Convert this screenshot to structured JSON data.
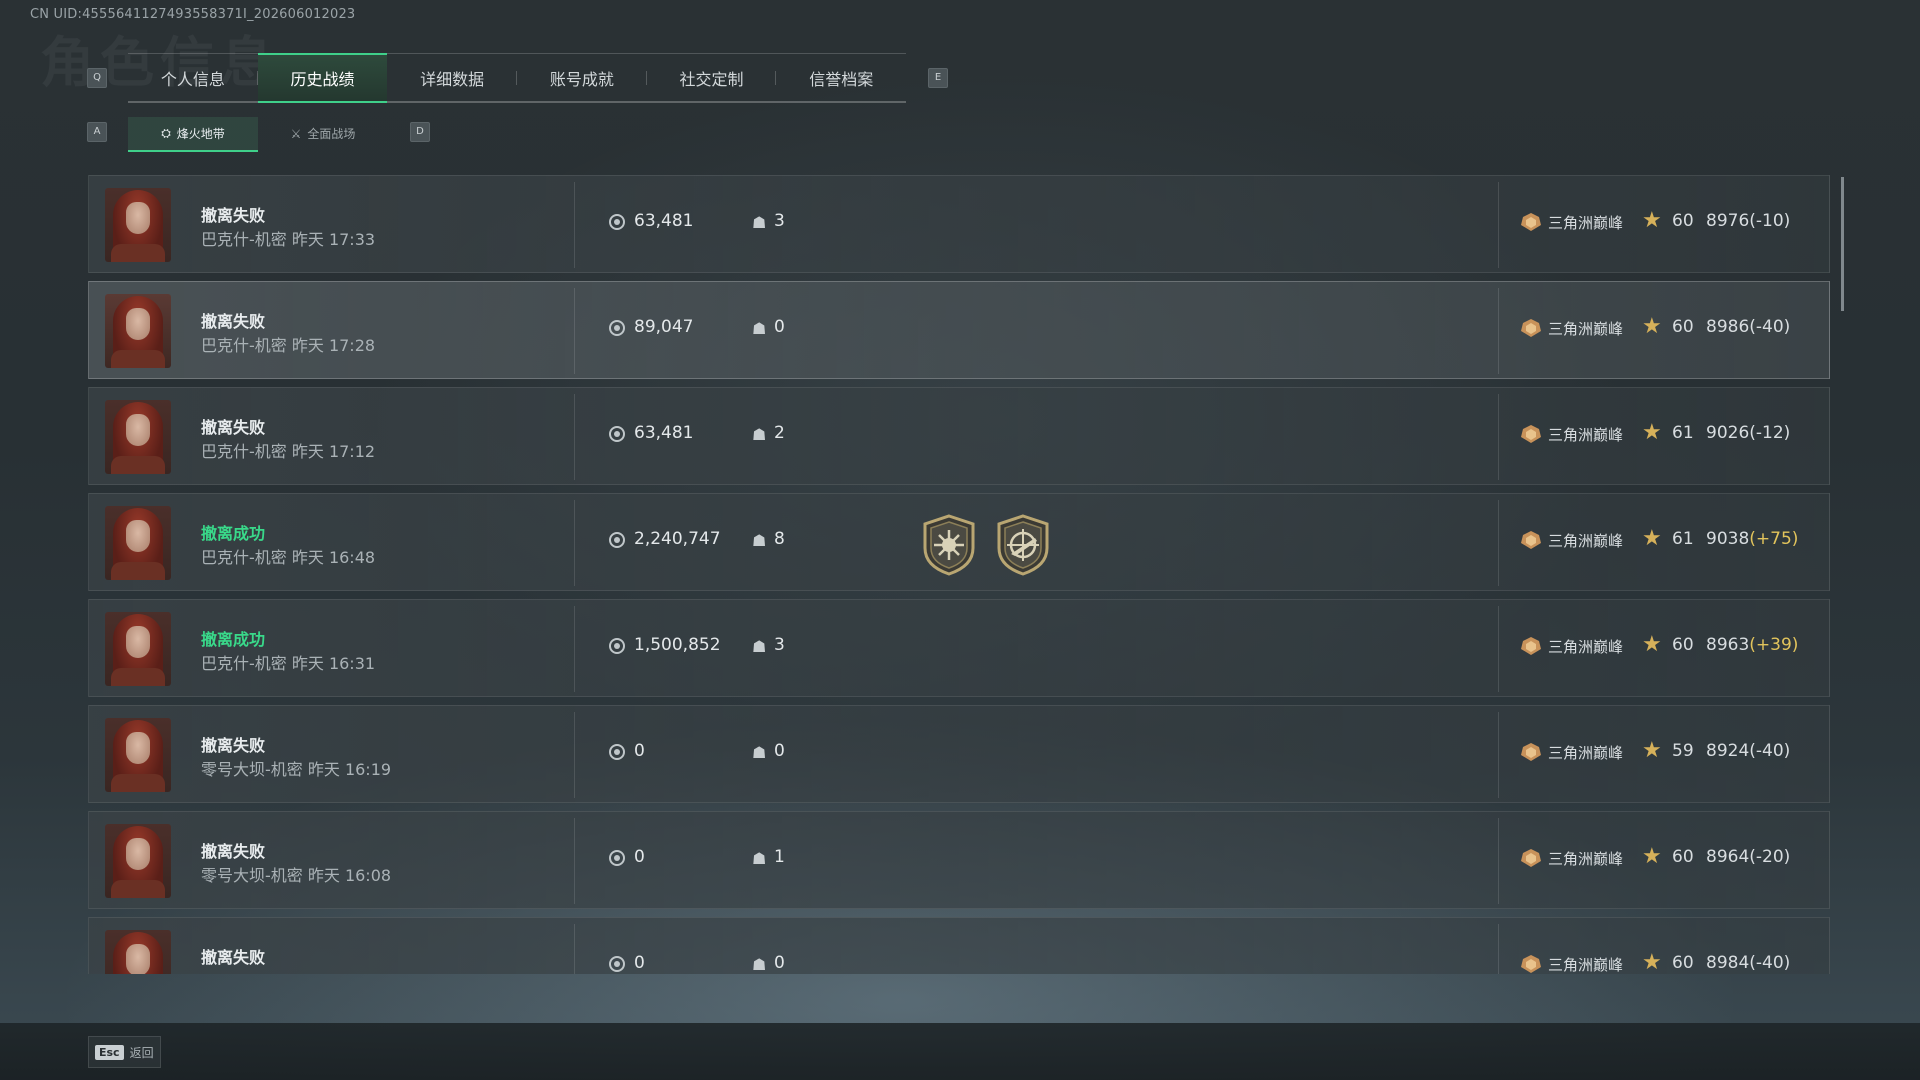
{
  "uid_text": "CN UID:4555641127493558371I_202606012023",
  "ghost_title": "角色信息",
  "keys": {
    "q": "Q",
    "e": "E",
    "a": "A",
    "d": "D"
  },
  "tabs": [
    {
      "label": "个人信息",
      "active": false
    },
    {
      "label": "历史战绩",
      "active": true
    },
    {
      "label": "详细数据",
      "active": false
    },
    {
      "label": "账号成就",
      "active": false
    },
    {
      "label": "社交定制",
      "active": false
    },
    {
      "label": "信誉档案",
      "active": false
    }
  ],
  "subtabs": [
    {
      "label": "烽火地带",
      "icon": "hazard-zone-icon",
      "active": true
    },
    {
      "label": "全面战场",
      "icon": "battlefield-icon",
      "active": false
    }
  ],
  "rows": [
    {
      "status": "撤离失败",
      "success": false,
      "map": "巴克什-机密 昨天 17:33",
      "money": "63,481",
      "kills": "3",
      "medals": [],
      "rank": "三角洲巅峰",
      "level": "60",
      "score": "8976",
      "delta": "(-10)",
      "highlight": false
    },
    {
      "status": "撤离失败",
      "success": false,
      "map": "巴克什-机密 昨天 17:28",
      "money": "89,047",
      "kills": "0",
      "medals": [],
      "rank": "三角洲巅峰",
      "level": "60",
      "score": "8986",
      "delta": "(-40)",
      "highlight": true
    },
    {
      "status": "撤离失败",
      "success": false,
      "map": "巴克什-机密 昨天 17:12",
      "money": "63,481",
      "kills": "2",
      "medals": [],
      "rank": "三角洲巅峰",
      "level": "61",
      "score": "9026",
      "delta": "(-12)",
      "highlight": false
    },
    {
      "status": "撤离成功",
      "success": true,
      "map": "巴克什-机密 昨天 16:48",
      "money": "2,240,747",
      "kills": "8",
      "medals": [
        "sun-emblem-medal-icon",
        "crosshair-gun-medal-icon"
      ],
      "rank": "三角洲巅峰",
      "level": "61",
      "score": "9038",
      "delta": "(+75)",
      "highlight": false
    },
    {
      "status": "撤离成功",
      "success": true,
      "map": "巴克什-机密 昨天 16:31",
      "money": "1,500,852",
      "kills": "3",
      "medals": [],
      "rank": "三角洲巅峰",
      "level": "60",
      "score": "8963",
      "delta": "(+39)",
      "highlight": false
    },
    {
      "status": "撤离失败",
      "success": false,
      "map": "零号大坝-机密 昨天 16:19",
      "money": "0",
      "kills": "0",
      "medals": [],
      "rank": "三角洲巅峰",
      "level": "59",
      "score": "8924",
      "delta": "(-40)",
      "highlight": false
    },
    {
      "status": "撤离失败",
      "success": false,
      "map": "零号大坝-机密 昨天 16:08",
      "money": "0",
      "kills": "1",
      "medals": [],
      "rank": "三角洲巅峰",
      "level": "60",
      "score": "8964",
      "delta": "(-20)",
      "highlight": false
    },
    {
      "status": "撤离失败",
      "success": false,
      "map": "",
      "money": "0",
      "kills": "0",
      "medals": [],
      "rank": "三角洲巅峰",
      "level": "60",
      "score": "8984",
      "delta": "(-40)",
      "highlight": false
    }
  ],
  "footer": {
    "esc_key": "Esc",
    "back_label": "返回"
  },
  "colors": {
    "accent": "#3fd08a",
    "success": "#39d98a",
    "gain": "#e2c45c",
    "star": "#d6b15a"
  }
}
